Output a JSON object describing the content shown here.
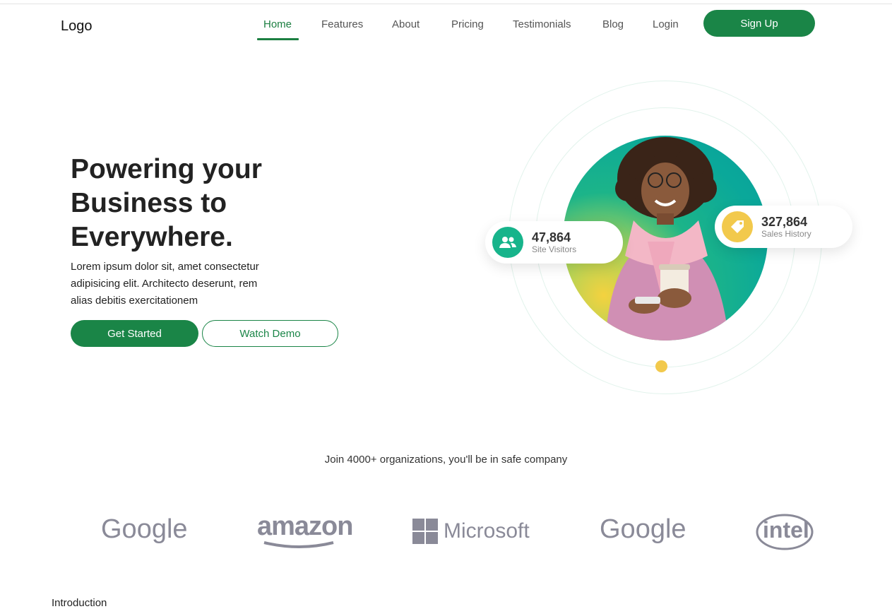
{
  "header": {
    "logo": "Logo",
    "nav": [
      "Home",
      "Features",
      "About",
      "Pricing",
      "Testimonials",
      "Blog",
      "Login"
    ],
    "active": "Home",
    "signup_label": "Sign Up"
  },
  "hero": {
    "title_lines": [
      "Powering your",
      "Business to",
      "Everywhere."
    ],
    "text_lines": [
      "Lorem ipsum dolor sit, amet consectetur",
      "adipisicing elit. Architecto deserunt, rem",
      "alias debitis exercitationem"
    ],
    "primary_button": "Get Started",
    "secondary_button": "Watch Demo"
  },
  "stats": [
    {
      "value": "47,864",
      "label": "Site Visitors",
      "icon": "users-icon",
      "color": "#17b48b"
    },
    {
      "value": "327,864",
      "label": "Sales History",
      "icon": "tag-icon",
      "color": "#f2c94c"
    }
  ],
  "partners": {
    "heading": "Join 4000+ organizations, you'll be in safe company",
    "logos": [
      "Google",
      "amazon",
      "Microsoft",
      "Google",
      "intel"
    ]
  },
  "section": {
    "title": "Introduction"
  },
  "colors": {
    "brand_green": "#1a8547",
    "accent_yellow": "#f2c94c",
    "logo_gray": "#8a8a98"
  }
}
